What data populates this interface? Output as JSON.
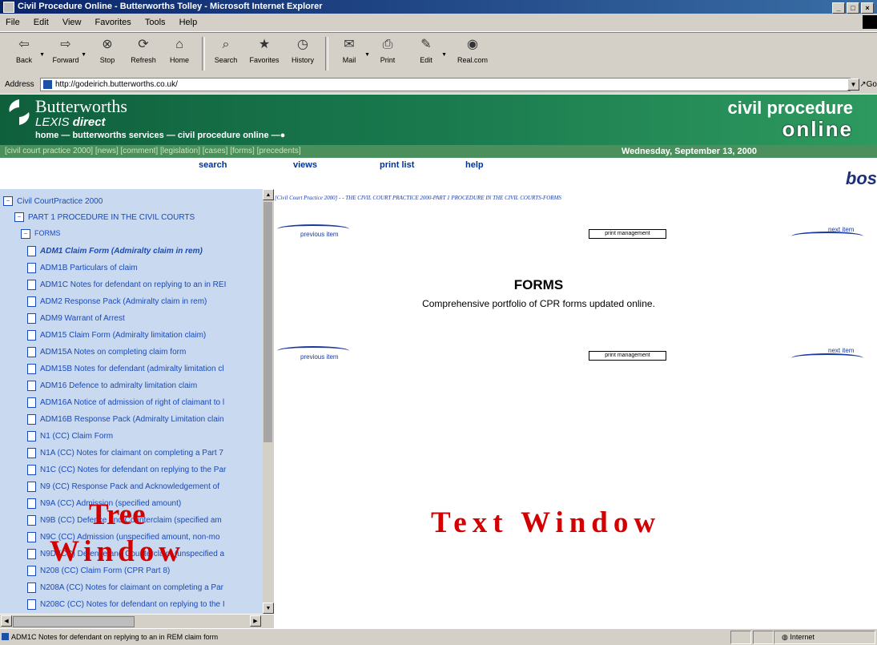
{
  "window": {
    "title": "Civil Procedure Online - Butterworths Tolley - Microsoft Internet Explorer"
  },
  "menu": [
    "File",
    "Edit",
    "View",
    "Favorites",
    "Tools",
    "Help"
  ],
  "toolbar": [
    {
      "label": "Back",
      "icon": "back-arrow-icon"
    },
    {
      "label": "Forward",
      "icon": "forward-arrow-icon"
    },
    {
      "label": "Stop",
      "icon": "stop-icon"
    },
    {
      "label": "Refresh",
      "icon": "refresh-icon"
    },
    {
      "label": "Home",
      "icon": "home-icon"
    },
    {
      "label": "Search",
      "icon": "search-icon"
    },
    {
      "label": "Favorites",
      "icon": "favorites-icon"
    },
    {
      "label": "History",
      "icon": "history-icon"
    },
    {
      "label": "Mail",
      "icon": "mail-icon"
    },
    {
      "label": "Print",
      "icon": "print-icon"
    },
    {
      "label": "Edit",
      "icon": "edit-icon"
    },
    {
      "label": "Real.com",
      "icon": "realcom-icon"
    }
  ],
  "address": {
    "label": "Address",
    "url": "http://godeirich.butterworths.co.uk/",
    "go": "Go"
  },
  "header": {
    "brand": "Butterworths",
    "sub_brand_a": "LEXIS",
    "sub_brand_b": "direct",
    "breadcrumb": "home — butterworths services — civil procedure online —●",
    "product_line1": "civil procedure",
    "product_line2": "online"
  },
  "nav": {
    "links": "[civil court practice 2000] [news] [comment] [legislation] [cases] [forms] [precedents]",
    "date": "Wednesday, September 13, 2000"
  },
  "actions": [
    "search",
    "views",
    "print list",
    "help"
  ],
  "bos_logo": "bos",
  "tree": {
    "items": [
      {
        "label": "Civil CourtPractice 2000",
        "level": 0,
        "type": "folder"
      },
      {
        "label": "PART 1 PROCEDURE IN THE CIVIL COURTS",
        "level": 1,
        "type": "folder"
      },
      {
        "label": "FORMS",
        "level": 2,
        "type": "folder"
      },
      {
        "label": "ADM1 Claim Form (Admiralty claim in rem)",
        "level": 3,
        "type": "doc",
        "selected": true
      },
      {
        "label": "ADM1B Particulars of claim",
        "level": 3,
        "type": "doc"
      },
      {
        "label": "ADM1C Notes for defendant on replying to an in REI",
        "level": 3,
        "type": "doc"
      },
      {
        "label": "ADM2 Response Pack (Admiralty claim in rem)",
        "level": 3,
        "type": "doc"
      },
      {
        "label": "ADM9 Warrant of Arrest",
        "level": 3,
        "type": "doc"
      },
      {
        "label": "ADM15 Claim Form (Admiralty limitation claim)",
        "level": 3,
        "type": "doc"
      },
      {
        "label": "ADM15A Notes on completing claim form",
        "level": 3,
        "type": "doc"
      },
      {
        "label": "ADM15B Notes for defendant (admiralty limitation cl",
        "level": 3,
        "type": "doc"
      },
      {
        "label": "ADM16 Defence to admiralty limitation claim",
        "level": 3,
        "type": "doc"
      },
      {
        "label": "ADM16A Notice of admission of right of claimant to l",
        "level": 3,
        "type": "doc"
      },
      {
        "label": "ADM16B Response Pack (Admiralty Limitation clain",
        "level": 3,
        "type": "doc"
      },
      {
        "label": "N1 (CC) Claim Form",
        "level": 3,
        "type": "doc"
      },
      {
        "label": "N1A (CC) Notes for claimant on completing a Part 7",
        "level": 3,
        "type": "doc"
      },
      {
        "label": "N1C (CC) Notes for defendant on replying to the Par",
        "level": 3,
        "type": "doc"
      },
      {
        "label": "N9 (CC) Response Pack and Acknowledgement of",
        "level": 3,
        "type": "doc"
      },
      {
        "label": "N9A (CC) Admission (specified amount)",
        "level": 3,
        "type": "doc"
      },
      {
        "label": "N9B (CC) Defence and Counterclaim (specified am",
        "level": 3,
        "type": "doc"
      },
      {
        "label": "N9C (CC) Admission (unspecified amount, non-mo",
        "level": 3,
        "type": "doc"
      },
      {
        "label": "N9D (CC) Defence and Counterclaim (unspecified a",
        "level": 3,
        "type": "doc"
      },
      {
        "label": "N208 (CC) Claim Form (CPR Part 8)",
        "level": 3,
        "type": "doc"
      },
      {
        "label": "N208A (CC) Notes for claimant on completing a Par",
        "level": 3,
        "type": "doc"
      },
      {
        "label": "N208C (CC) Notes for defendant on replying to the I",
        "level": 3,
        "type": "doc"
      }
    ]
  },
  "content": {
    "crumb": "[Civil Court Practice 2000] - - THE CIVIL COURT PRACTICE 2000-PART 1 PROCEDURE IN THE CIVIL COURTS-FORMS",
    "previous_item": "previous item",
    "next_item": "next item",
    "print_management": "print management",
    "title": "FORMS",
    "subtitle": "Comprehensive portfolio of CPR forms updated online."
  },
  "annotations": {
    "tree_line1": "Tree",
    "tree_line2": "Window",
    "text_window": "Text Window"
  },
  "status": {
    "text": "ADM1C Notes for defendant on replying to an in REM claim form",
    "zone": "Internet"
  }
}
